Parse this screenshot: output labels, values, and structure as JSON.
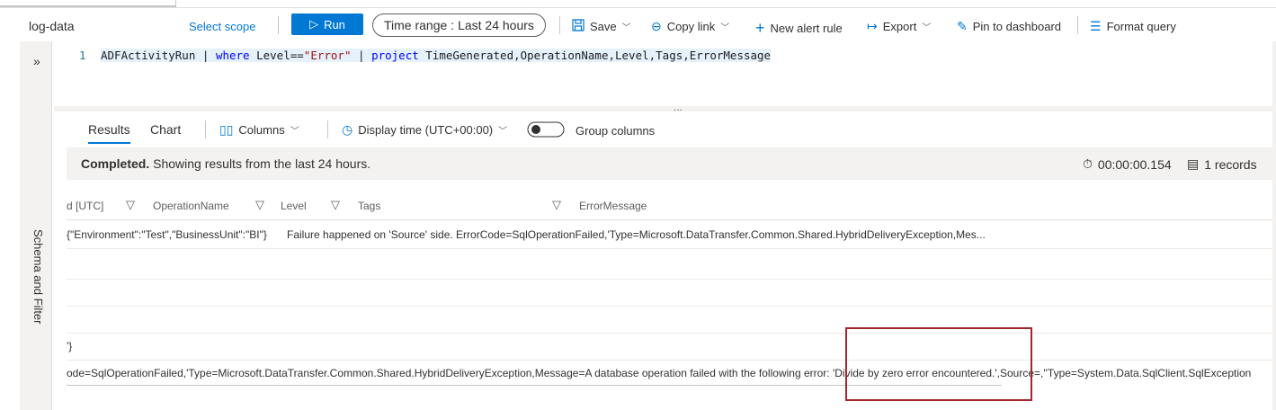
{
  "toolbar": {
    "workspace": "log-data",
    "select_scope": "Select scope",
    "run_label": "Run",
    "time_range_prefix": "Time range :",
    "time_range_value": "Last 24 hours",
    "save": "Save",
    "copy_link": "Copy link",
    "new_alert_rule": "New alert rule",
    "export": "Export",
    "pin_to_dashboard": "Pin to dashboard",
    "format_query": "Format query"
  },
  "sidebar": {
    "expand_glyph": "»",
    "label": "Schema and Filter"
  },
  "editor": {
    "line_number": "1",
    "tokens": {
      "t1": "ADFActivityRun | ",
      "t2": "where",
      "t3": " Level==",
      "t4": "\"Error\"",
      "t5": " | ",
      "t6": "project",
      "t7": " TimeGenerated,OperationName,Level,Tags,ErrorMessage"
    },
    "splitter_glyph": "..."
  },
  "results": {
    "tabs": [
      "Results",
      "Chart"
    ],
    "columns_label": "Columns",
    "display_time": "Display time (UTC+00:00)",
    "group_columns": "Group columns",
    "status_bold": "Completed.",
    "status_rest": " Showing results from the last 24 hours.",
    "elapsed": "00:00:00.154",
    "records": "1 records"
  },
  "grid": {
    "headers": [
      "d [UTC]",
      "OperationName",
      "Level",
      "Tags",
      "ErrorMessage"
    ],
    "row1_tags": "{\"Environment\":\"Test\",\"BusinessUnit\":\"BI\"}",
    "row1_error": "Failure happened on 'Source' side. ErrorCode=SqlOperationFailed,'Type=Microsoft.DataTransfer.Common.Shared.HybridDeliveryException,Mes...",
    "row5_text": "'}",
    "row6_text": "ode=SqlOperationFailed,'Type=Microsoft.DataTransfer.Common.Shared.HybridDeliveryException,Message=A database operation failed with the following error: 'Divide by zero error encountered.',Source=,''Type=System.Data.SqlClient.SqlException"
  },
  "colors": {
    "accent": "#0078d4",
    "highlight_box": "#a4262c"
  },
  "icons": [
    "run-icon",
    "save-icon",
    "copy-link-icon",
    "plus-icon",
    "export-icon",
    "pin-icon",
    "format-icon",
    "columns-icon",
    "clock-icon",
    "toggle-icon",
    "filter-icon",
    "stopwatch-icon",
    "records-icon",
    "expand-icon"
  ]
}
